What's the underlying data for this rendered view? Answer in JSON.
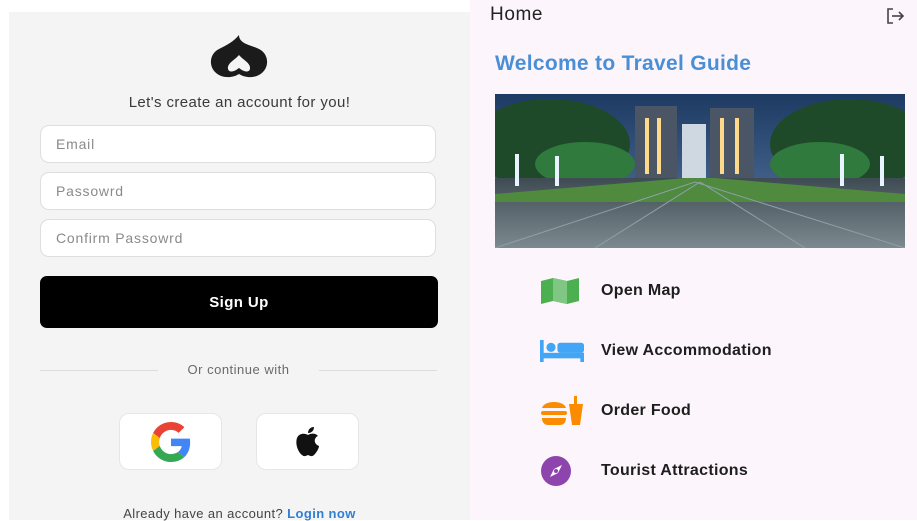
{
  "signup": {
    "tagline": "Let's create an account for you!",
    "email_placeholder": "Email",
    "password_placeholder": "Passowrd",
    "confirm_placeholder": "Confirm Passowrd",
    "signup_label": "Sign Up",
    "divider_text": "Or continue with",
    "social": [
      "google-icon",
      "apple-icon"
    ],
    "already_text": "Already have an account?",
    "login_text": "Login now"
  },
  "home": {
    "title": "Home",
    "welcome": "Welcome to Travel Guide",
    "menu": [
      {
        "label": "Open Map",
        "icon": "map-icon"
      },
      {
        "label": "View Accommodation",
        "icon": "hotel-bed-icon"
      },
      {
        "label": "Order Food",
        "icon": "fast-food-icon"
      },
      {
        "label": "Tourist Attractions",
        "icon": "compass-icon"
      }
    ]
  },
  "colors": {
    "accent": "#4a8fd6",
    "link": "#2f7fd3",
    "button": "#000000",
    "map_green": "#4caf50",
    "bed_blue": "#42a5f5",
    "food_orange": "#fb8c00",
    "compass_purple": "#8e44ad"
  }
}
